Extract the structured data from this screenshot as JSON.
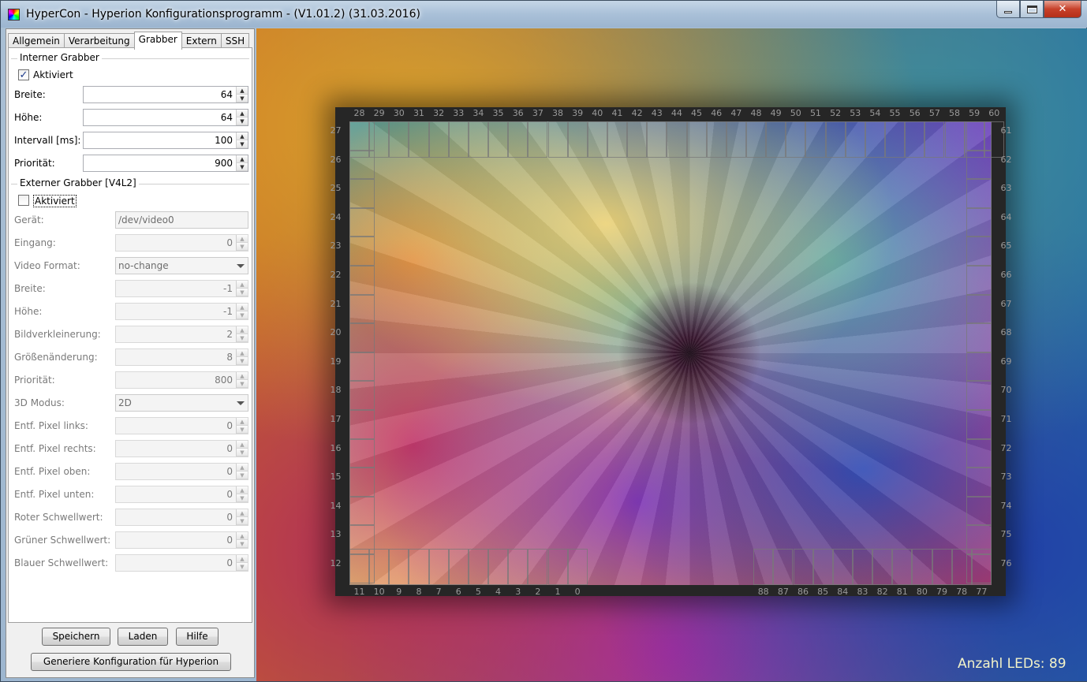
{
  "window": {
    "title": "HyperCon - Hyperion Konfigurationsprogramm - (V1.01.2) (31.03.2016)"
  },
  "tabs": [
    "Allgemein",
    "Verarbeitung",
    "Grabber",
    "Extern",
    "SSH"
  ],
  "active_tab": "Grabber",
  "internal": {
    "title": "Interner Grabber",
    "enabled_label": "Aktiviert",
    "enabled": true,
    "fields": [
      {
        "label": "Breite:",
        "value": "64"
      },
      {
        "label": "Höhe:",
        "value": "64"
      },
      {
        "label": "Intervall [ms]:",
        "value": "100"
      },
      {
        "label": "Priorität:",
        "value": "900"
      }
    ]
  },
  "external": {
    "title": "Externer Grabber [V4L2]",
    "enabled_label": "Aktiviert",
    "enabled": false,
    "device_label": "Gerät:",
    "device_value": "/dev/video0",
    "input_label": "Eingang:",
    "input_value": "0",
    "format_label": "Video Format:",
    "format_value": "no-change",
    "width_label": "Breite:",
    "width_value": "-1",
    "height_label": "Höhe:",
    "height_value": "-1",
    "decimation_label": "Bildverkleinerung:",
    "decimation_value": "2",
    "resize_label": "Größenänderung:",
    "resize_value": "8",
    "priority_label": "Priorität:",
    "priority_value": "800",
    "mode_label": "3D Modus:",
    "mode_value": "2D",
    "crop_left_label": "Entf. Pixel links:",
    "crop_left_value": "0",
    "crop_right_label": "Entf. Pixel rechts:",
    "crop_right_value": "0",
    "crop_top_label": "Entf. Pixel oben:",
    "crop_top_value": "0",
    "crop_bottom_label": "Entf. Pixel unten:",
    "crop_bottom_value": "0",
    "red_label": "Roter Schwellwert:",
    "red_value": "0",
    "green_label": "Grüner Schwellwert:",
    "green_value": "0",
    "blue_label": "Blauer Schwellwert:",
    "blue_value": "0"
  },
  "buttons": {
    "save": "Speichern",
    "load": "Laden",
    "help": "Hilfe",
    "generate": "Generiere Konfiguration für Hyperion"
  },
  "preview": {
    "led_count_text": "Anzahl LEDs: 89",
    "top_numbers": [
      "28",
      "29",
      "30",
      "31",
      "32",
      "33",
      "34",
      "35",
      "36",
      "37",
      "38",
      "39",
      "40",
      "41",
      "42",
      "43",
      "44",
      "45",
      "46",
      "47",
      "48",
      "49",
      "50",
      "51",
      "52",
      "53",
      "54",
      "55",
      "56",
      "57",
      "58",
      "59",
      "60"
    ],
    "left_numbers": [
      "27",
      "26",
      "25",
      "24",
      "23",
      "22",
      "21",
      "20",
      "19",
      "18",
      "17",
      "16",
      "15",
      "14",
      "13",
      "12"
    ],
    "right_numbers": [
      "61",
      "62",
      "63",
      "64",
      "65",
      "66",
      "67",
      "68",
      "69",
      "70",
      "71",
      "72",
      "73",
      "74",
      "75",
      "76"
    ],
    "bottom_left_numbers": [
      "11",
      "10",
      "9",
      "8",
      "7",
      "6",
      "5",
      "4",
      "3",
      "2",
      "1",
      "0"
    ],
    "bottom_right_numbers": [
      "88",
      "87",
      "86",
      "85",
      "84",
      "83",
      "82",
      "81",
      "80",
      "79",
      "78",
      "77"
    ]
  },
  "icons": {
    "app": "hypercon-app-icon",
    "minimize": "minimize-icon",
    "maximize": "maximize-icon",
    "close": "close-icon"
  }
}
